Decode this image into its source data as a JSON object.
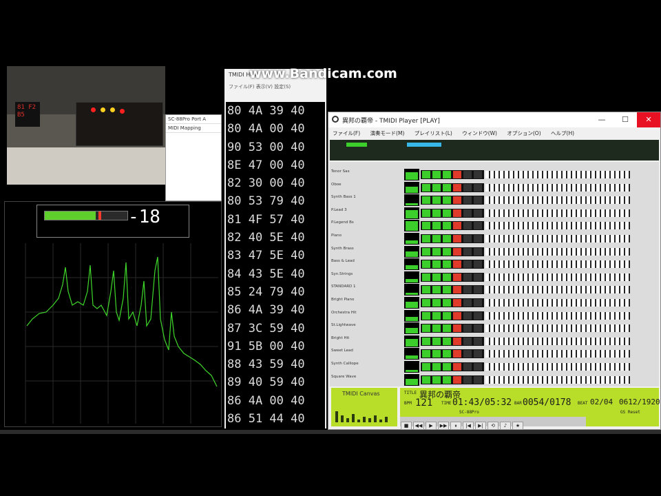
{
  "watermark": "www.Bandicam.com",
  "camera": {
    "display_text": "81 F2 B5"
  },
  "midi_out_window": {
    "rows": [
      "SC-88Pro Port A",
      "MIDI Mapping"
    ]
  },
  "level_meter": {
    "value": "-18",
    "fill_fraction": 0.62
  },
  "hex_window": {
    "title": "TMIDI Hex",
    "menu": [
      "ファイル(F)",
      "表示(V)",
      "設定(S)"
    ]
  },
  "hex_rows": [
    "80 4A 39 40",
    "80 4A 00 40",
    "90 53 00 40",
    "8E 47 00 40",
    "82 30 00 40",
    "80 53 79 40",
    "81 4F 57 40",
    "82 40 5E 40",
    "83 47 5E 40",
    "84 43 5E 40",
    "85 24 79 40",
    "86 4A 39 40",
    "87 3C 59 40",
    "91 5B 00 40",
    "88 43 59 40",
    "89 40 59 40",
    "86 4A 00 40",
    "86 51 44 40"
  ],
  "tmidi": {
    "title": "異邦の覇帝 - TMIDI Player [PLAY]",
    "buttons": {
      "minimize": "—",
      "maximize": "☐",
      "close": "✕"
    },
    "menu": [
      "ファイル(F)",
      "演奏モード(M)",
      "プレイリスト(L)",
      "ウィンドウ(W)",
      "オプション(O)",
      "ヘルプ(H)"
    ],
    "channels": [
      {
        "label": "Tenor Sax",
        "level": 0.7
      },
      {
        "label": "Oboe",
        "level": 0.6
      },
      {
        "label": "Synth Bass 1",
        "level": 0.2
      },
      {
        "label": "P.Lead 3",
        "level": 0.8
      },
      {
        "label": "P.Legend Bs",
        "level": 0.9
      },
      {
        "label": "Piano",
        "level": 0.3
      },
      {
        "label": "Synth Brass",
        "level": 0.5
      },
      {
        "label": "Bass & Lead",
        "level": 0.4
      },
      {
        "label": "Syn.Strings",
        "level": 0.3
      },
      {
        "label": "STANDARD 1",
        "level": 0.2
      },
      {
        "label": "Bright Piano",
        "level": 0.6
      },
      {
        "label": "Orchestra Hit",
        "level": 0.4
      },
      {
        "label": "St.Lightwave",
        "level": 0.5
      },
      {
        "label": "Bright Hit",
        "level": 0.7
      },
      {
        "label": "Sweet Lead",
        "level": 0.3
      },
      {
        "label": "Synth Calliope",
        "level": 0.2
      },
      {
        "label": "Square Wave",
        "level": 0.6
      }
    ],
    "lcd_left_label": "TMIDI Canvas",
    "lcd": {
      "title_tag": "TITLE",
      "title": "異邦の覇帝",
      "bpm_tag": "BPM",
      "bpm": "121",
      "time_tag": "TIME",
      "time": "01:43/05:32",
      "bar_tag": "BAR",
      "bar": "0054/0178",
      "beat_tag": "BEAT",
      "beat": "02/04",
      "tick": "0612/1920",
      "sub_left": "SC-88Pro",
      "sub_right": "GS Reset"
    },
    "transport": [
      "■",
      "◀◀",
      "▶",
      "▶▶",
      "⏸",
      "|◀",
      "▶|",
      "⟲",
      "♪",
      "★"
    ]
  }
}
